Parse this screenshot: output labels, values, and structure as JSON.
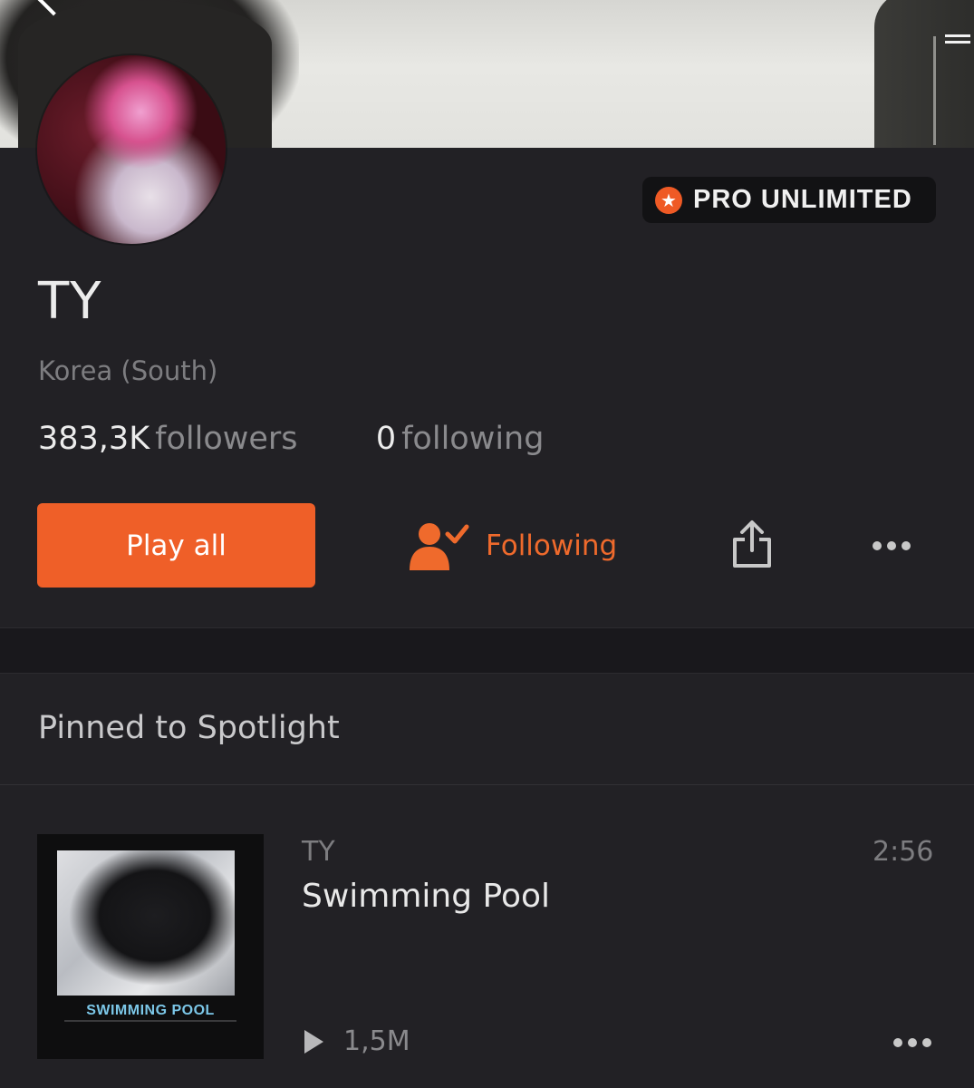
{
  "header": {
    "back_icon": "chevron-left-icon",
    "badge_label": "PRO UNLIMITED",
    "badge_icon": "star-icon",
    "accent_color": "#ef5f28"
  },
  "profile": {
    "name": "TY",
    "location": "Korea (South)",
    "followers_count": "383,3K",
    "followers_label": "followers",
    "following_count": "0",
    "following_label": "following"
  },
  "actions": {
    "play_all_label": "Play all",
    "follow_label": "Following",
    "follow_icon": "user-check-icon",
    "share_icon": "share-icon",
    "more_icon": "more-icon"
  },
  "spotlight": {
    "title": "Pinned to Spotlight",
    "tracks": [
      {
        "artist": "TY",
        "title": "Swimming Pool",
        "duration": "2:56",
        "plays": "1,5M",
        "artwork_caption": "SWIMMING POOL"
      }
    ]
  }
}
